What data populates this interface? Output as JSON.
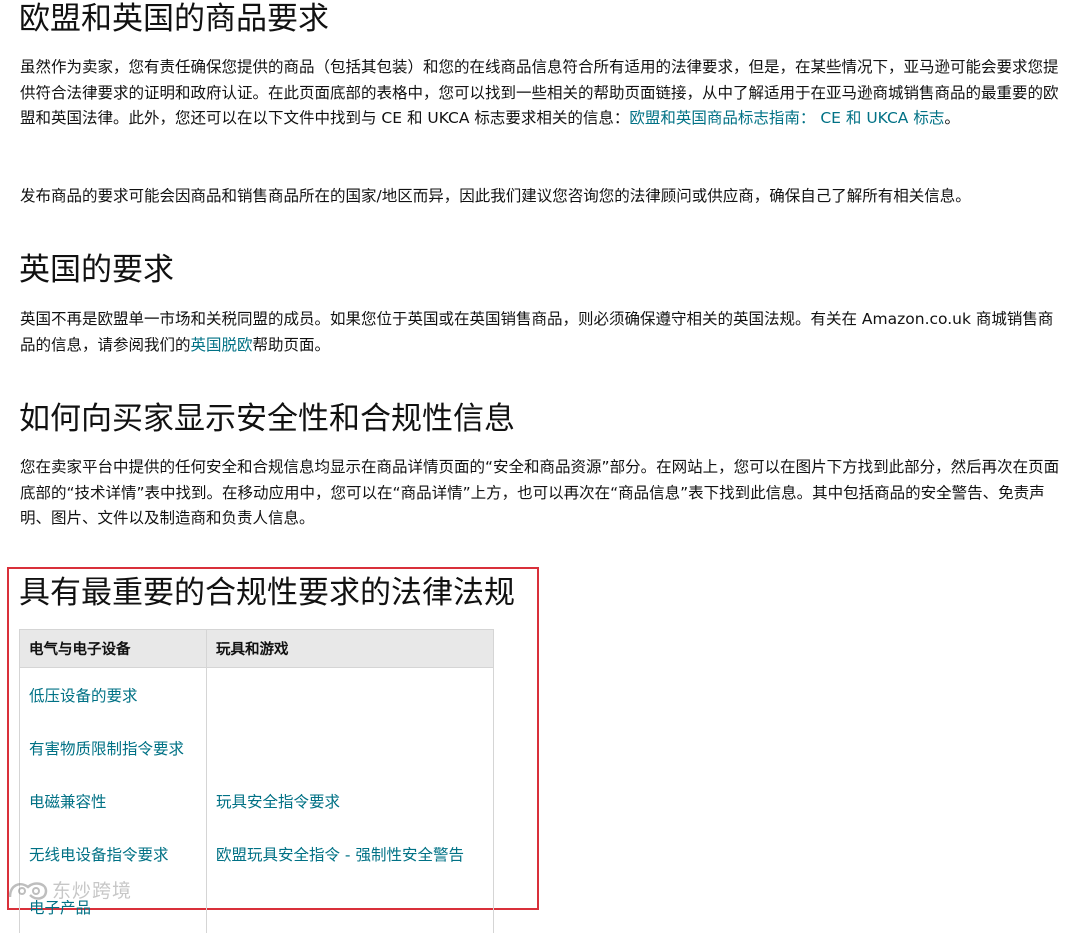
{
  "sections": {
    "eu_uk": {
      "title": "欧盟和英国的商品要求",
      "p1_text": "虽然作为卖家，您有责任确保您提供的商品（包括其包装）和您的在线商品信息符合所有适用的法律要求，但是，在某些情况下，亚马逊可能会要求您提供符合法律要求的证明和政府认证。在此页面底部的表格中，您可以找到一些相关的帮助页面链接，从中了解适用于在亚马逊商城销售商品的最重要的欧盟和英国法律。此外，您还可以在以下文件中找到与 CE 和 UKCA 标志要求相关的信息：",
      "p1_link": "欧盟和英国商品标志指南： CE 和 UKCA 标志",
      "p1_end": "。",
      "p2_text": "发布商品的要求可能会因商品和销售商品所在的国家/地区而异，因此我们建议您咨询您的法律顾问或供应商，确保自己了解所有相关信息。"
    },
    "uk": {
      "title": "英国的要求",
      "p_text": "英国不再是欧盟单一市场和关税同盟的成员。如果您位于英国或在英国销售商品，则必须确保遵守相关的英国法规。有关在 Amazon.co.uk 商城销售商品的信息，请参阅我们的",
      "p_link": "英国脱欧",
      "p_end": "帮助页面。"
    },
    "display": {
      "title": "如何向买家显示安全性和合规性信息",
      "p_text": "您在卖家平台中提供的任何安全和合规信息均显示在商品详情页面的“安全和商品资源”部分。在网站上，您可以在图片下方找到此部分，然后再次在页面底部的“技术详情”表中找到。在移动应用中，您可以在“商品详情”上方，也可以再次在“商品信息”表下找到此信息。其中包括商品的安全警告、免责声明、图片、文件以及制造商和负责人信息。"
    },
    "laws": {
      "title": "具有最重要的合规性要求的法律法规",
      "table": {
        "headers": [
          "电气与电子设备",
          "玩具和游戏"
        ],
        "rows": [
          [
            "低压设备的要求",
            ""
          ],
          [
            "有害物质限制指令要求",
            ""
          ],
          [
            "电磁兼容性",
            "玩具安全指令要求"
          ],
          [
            "无线电设备指令要求",
            "欧盟玩具安全指令 - 强制性安全警告"
          ],
          [
            "电子产品",
            ""
          ]
        ]
      }
    }
  },
  "watermark": {
    "icon": "watermark-logo-icon",
    "text": "东炒跨境"
  },
  "colors": {
    "link": "#007185",
    "highlight_border": "#d9303a",
    "table_header_bg": "#e8e8e8"
  }
}
